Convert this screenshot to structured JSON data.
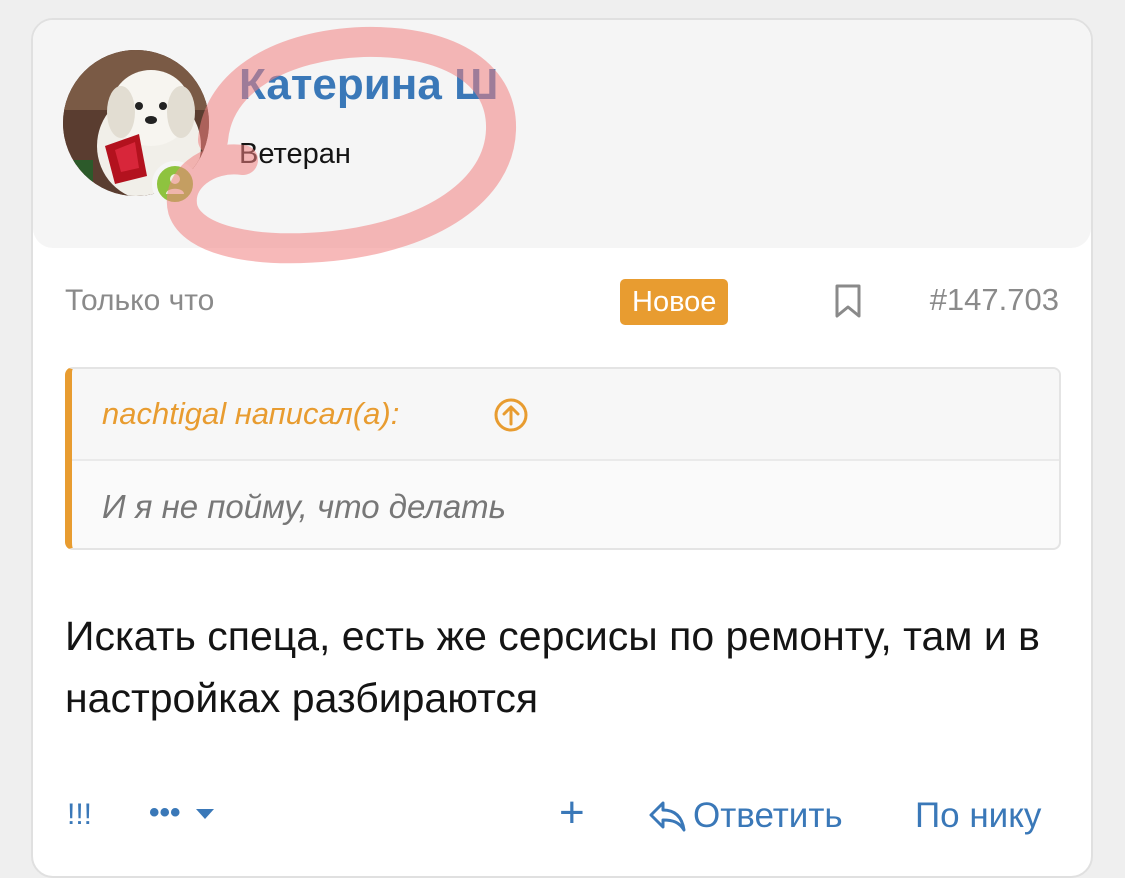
{
  "post": {
    "author": {
      "name": "Катерина Ш",
      "title": "Ветеран",
      "status_icon": "user-online-icon"
    },
    "meta": {
      "time": "Только что",
      "badge": "Новое",
      "post_number": "#147.703"
    },
    "quote": {
      "author_line": "nachtigal написал(а):",
      "text": "И я не пойму, что делать"
    },
    "message": "Искать спеца, есть же серсисы по ремонту, там и в настройках разбираются",
    "actions": {
      "report": "!!!",
      "more": "•••",
      "plus": "+",
      "reply": "Ответить",
      "by_nick": "По нику"
    }
  },
  "colors": {
    "accent": "#3a78b8",
    "badge": "#e89c30",
    "online": "#8ec33f",
    "annotation": "#f08080"
  }
}
